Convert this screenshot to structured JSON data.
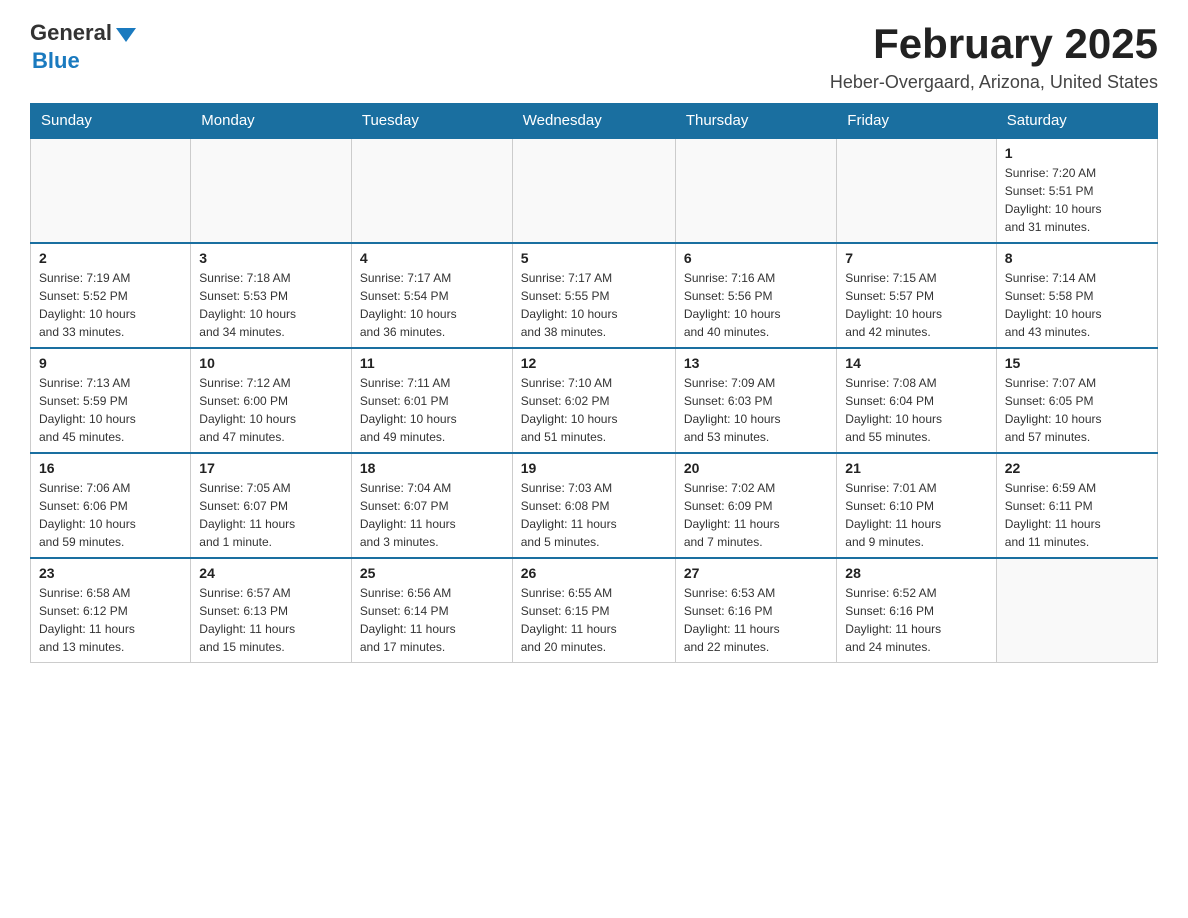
{
  "logo": {
    "general": "General",
    "blue": "Blue"
  },
  "title": "February 2025",
  "location": "Heber-Overgaard, Arizona, United States",
  "days_of_week": [
    "Sunday",
    "Monday",
    "Tuesday",
    "Wednesday",
    "Thursday",
    "Friday",
    "Saturday"
  ],
  "weeks": [
    [
      {
        "day": "",
        "info": ""
      },
      {
        "day": "",
        "info": ""
      },
      {
        "day": "",
        "info": ""
      },
      {
        "day": "",
        "info": ""
      },
      {
        "day": "",
        "info": ""
      },
      {
        "day": "",
        "info": ""
      },
      {
        "day": "1",
        "info": "Sunrise: 7:20 AM\nSunset: 5:51 PM\nDaylight: 10 hours\nand 31 minutes."
      }
    ],
    [
      {
        "day": "2",
        "info": "Sunrise: 7:19 AM\nSunset: 5:52 PM\nDaylight: 10 hours\nand 33 minutes."
      },
      {
        "day": "3",
        "info": "Sunrise: 7:18 AM\nSunset: 5:53 PM\nDaylight: 10 hours\nand 34 minutes."
      },
      {
        "day": "4",
        "info": "Sunrise: 7:17 AM\nSunset: 5:54 PM\nDaylight: 10 hours\nand 36 minutes."
      },
      {
        "day": "5",
        "info": "Sunrise: 7:17 AM\nSunset: 5:55 PM\nDaylight: 10 hours\nand 38 minutes."
      },
      {
        "day": "6",
        "info": "Sunrise: 7:16 AM\nSunset: 5:56 PM\nDaylight: 10 hours\nand 40 minutes."
      },
      {
        "day": "7",
        "info": "Sunrise: 7:15 AM\nSunset: 5:57 PM\nDaylight: 10 hours\nand 42 minutes."
      },
      {
        "day": "8",
        "info": "Sunrise: 7:14 AM\nSunset: 5:58 PM\nDaylight: 10 hours\nand 43 minutes."
      }
    ],
    [
      {
        "day": "9",
        "info": "Sunrise: 7:13 AM\nSunset: 5:59 PM\nDaylight: 10 hours\nand 45 minutes."
      },
      {
        "day": "10",
        "info": "Sunrise: 7:12 AM\nSunset: 6:00 PM\nDaylight: 10 hours\nand 47 minutes."
      },
      {
        "day": "11",
        "info": "Sunrise: 7:11 AM\nSunset: 6:01 PM\nDaylight: 10 hours\nand 49 minutes."
      },
      {
        "day": "12",
        "info": "Sunrise: 7:10 AM\nSunset: 6:02 PM\nDaylight: 10 hours\nand 51 minutes."
      },
      {
        "day": "13",
        "info": "Sunrise: 7:09 AM\nSunset: 6:03 PM\nDaylight: 10 hours\nand 53 minutes."
      },
      {
        "day": "14",
        "info": "Sunrise: 7:08 AM\nSunset: 6:04 PM\nDaylight: 10 hours\nand 55 minutes."
      },
      {
        "day": "15",
        "info": "Sunrise: 7:07 AM\nSunset: 6:05 PM\nDaylight: 10 hours\nand 57 minutes."
      }
    ],
    [
      {
        "day": "16",
        "info": "Sunrise: 7:06 AM\nSunset: 6:06 PM\nDaylight: 10 hours\nand 59 minutes."
      },
      {
        "day": "17",
        "info": "Sunrise: 7:05 AM\nSunset: 6:07 PM\nDaylight: 11 hours\nand 1 minute."
      },
      {
        "day": "18",
        "info": "Sunrise: 7:04 AM\nSunset: 6:07 PM\nDaylight: 11 hours\nand 3 minutes."
      },
      {
        "day": "19",
        "info": "Sunrise: 7:03 AM\nSunset: 6:08 PM\nDaylight: 11 hours\nand 5 minutes."
      },
      {
        "day": "20",
        "info": "Sunrise: 7:02 AM\nSunset: 6:09 PM\nDaylight: 11 hours\nand 7 minutes."
      },
      {
        "day": "21",
        "info": "Sunrise: 7:01 AM\nSunset: 6:10 PM\nDaylight: 11 hours\nand 9 minutes."
      },
      {
        "day": "22",
        "info": "Sunrise: 6:59 AM\nSunset: 6:11 PM\nDaylight: 11 hours\nand 11 minutes."
      }
    ],
    [
      {
        "day": "23",
        "info": "Sunrise: 6:58 AM\nSunset: 6:12 PM\nDaylight: 11 hours\nand 13 minutes."
      },
      {
        "day": "24",
        "info": "Sunrise: 6:57 AM\nSunset: 6:13 PM\nDaylight: 11 hours\nand 15 minutes."
      },
      {
        "day": "25",
        "info": "Sunrise: 6:56 AM\nSunset: 6:14 PM\nDaylight: 11 hours\nand 17 minutes."
      },
      {
        "day": "26",
        "info": "Sunrise: 6:55 AM\nSunset: 6:15 PM\nDaylight: 11 hours\nand 20 minutes."
      },
      {
        "day": "27",
        "info": "Sunrise: 6:53 AM\nSunset: 6:16 PM\nDaylight: 11 hours\nand 22 minutes."
      },
      {
        "day": "28",
        "info": "Sunrise: 6:52 AM\nSunset: 6:16 PM\nDaylight: 11 hours\nand 24 minutes."
      },
      {
        "day": "",
        "info": ""
      }
    ]
  ]
}
